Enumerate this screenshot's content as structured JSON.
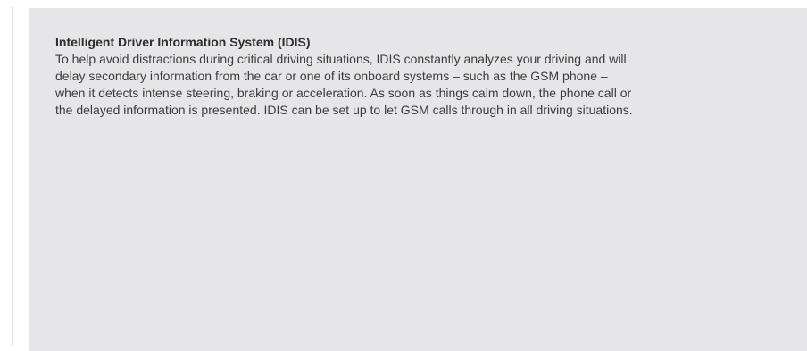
{
  "info_box": {
    "title": "Intelligent Driver Information System (IDIS)",
    "lines": [
      "To help avoid distractions during critical driving situations, IDIS constantly analyzes your driving and will",
      "delay secondary information from the car or one of its onboard systems – such as the GSM phone –",
      "when it detects intense steering, braking or acceleration. As soon as things calm down, the phone call or",
      "the delayed information is presented. IDIS can be set up to let GSM calls through in all driving situations."
    ]
  }
}
